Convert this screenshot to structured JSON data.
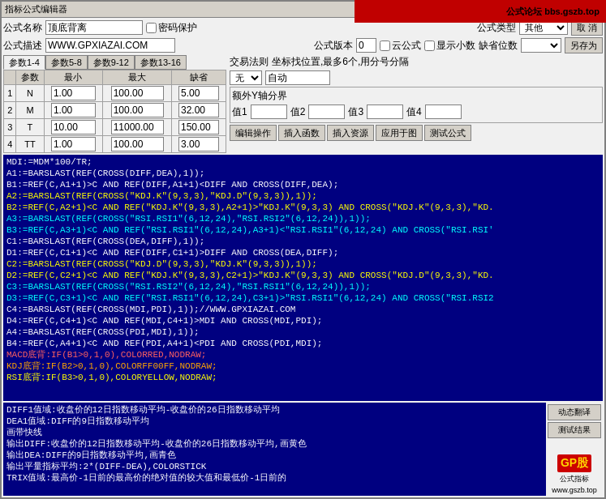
{
  "window": {
    "title": "指标公式编辑器"
  },
  "banner": {
    "text": "公式论坛 bbs.gszb.top"
  },
  "form": {
    "formula_name_label": "公式名称",
    "formula_name_value": "顶底背离",
    "password_label": "密码保护",
    "formula_type_label": "公式类型",
    "formula_type_value": "其他",
    "formula_desc_label": "公式描述",
    "formula_desc_value": "WWW.GPXIAZAI.COM",
    "formula_version_label": "公式版本",
    "formula_version_value": "0",
    "cloud_formula_label": "云公式",
    "show_small_label": "显示小数",
    "default_digits_label": "缺省位数",
    "cancel_btn": "取 消",
    "save_as_btn": "另存为"
  },
  "params": {
    "tabs": [
      "参数1-4",
      "参数5-8",
      "参数9-12",
      "参数13-16"
    ],
    "active_tab": 0,
    "headers": [
      "参数",
      "最小",
      "最大",
      "缺省"
    ],
    "rows": [
      {
        "num": "1",
        "name": "N",
        "min": "1.00",
        "max": "100.00",
        "default": "5.00"
      },
      {
        "num": "2",
        "name": "M",
        "min": "1.00",
        "max": "100.00",
        "default": "32.00"
      },
      {
        "num": "3",
        "name": "T",
        "min": "10.00",
        "max": "11000.00",
        "default": "150.00"
      },
      {
        "num": "4",
        "name": "TT",
        "min": "1.00",
        "max": "100.00",
        "default": "3.00"
      }
    ]
  },
  "exchange": {
    "label": "交易法则",
    "coord_label": "坐标找位置,最多6个,用分号分隔",
    "field1": "无",
    "field2": "自动"
  },
  "y_boundary": {
    "label": "额外Y轴分界",
    "val1_label": "值1",
    "val2_label": "值2",
    "val3_label": "值3",
    "val4_label": "值4"
  },
  "action_buttons": {
    "edit_ops": "编辑操作",
    "insert_fn": "插入函数",
    "insert_res": "插入资源",
    "apply_chart": "应用于图",
    "test_formula": "测试公式"
  },
  "code": [
    {
      "text": "MDI:=MDM*100/TR;",
      "color": "white"
    },
    {
      "text": "A1:=BARSLAST(REF(CROSS(DIFF,DEA),1));",
      "color": "white"
    },
    {
      "text": "B1:=REF(C,A1+1)>C AND REF(DIFF,A1+1)<DIFF AND CROSS(DIFF,DEA);",
      "color": "white"
    },
    {
      "text": "A2:=BARSLAST(REF(CROSS(\"KDJ.K\"(9,3,3),\"KDJ.D\"(9,3,3)),1));",
      "color": "yellow"
    },
    {
      "text": "B2:=REF(C,A2+1)<C AND REF(\"KDJ.K\"(9,3,3),A2+1)>\"KDJ.K\"(9,3,3) AND CROSS(\"KDJ.K\"(9,3,3),\"KD.",
      "color": "yellow"
    },
    {
      "text": "A3:=BARSLAST(REF(CROSS(\"RSI.RSI1\"(6,12,24),\"RSI.RSI2\"(6,12,24)),1));",
      "color": "cyan"
    },
    {
      "text": "B3:=REF(C,A3+1)<C AND REF(\"RSI.RSI1\"(6,12,24),A3+1)<\"RSI.RSI1\"(6,12,24) AND CROSS(\"RSI.RSI'",
      "color": "cyan"
    },
    {
      "text": "C1:=BARSLAST(REF(CROSS(DEA,DIFF),1));",
      "color": "white"
    },
    {
      "text": "D1:=REF(C,C1+1)<C AND REF(DIFF,C1+1)>DIFF AND CROSS(DEA,DIFF);",
      "color": "white"
    },
    {
      "text": "C2:=BARSLAST(REF(CROSS(\"KDJ.D\"(9,3,3),\"KDJ.K\"(9,3,3)),1));",
      "color": "yellow"
    },
    {
      "text": "D2:=REF(C,C2+1)<C AND REF(\"KDJ.K\"(9,3,3),C2+1)>\"KDJ.K\"(9,3,3) AND CROSS(\"KDJ.D\"(9,3,3),\"KD.",
      "color": "yellow"
    },
    {
      "text": "C3:=BARSLAST(REF(CROSS(\"RSI.RSI2\"(6,12,24),\"RSI.RSI1\"(6,12,24)),1));",
      "color": "cyan"
    },
    {
      "text": "D3:=REF(C,C3+1)<C AND REF(\"RSI.RSI1\"(6,12,24),C3+1)>\"RSI.RSI1\"(6,12,24) AND CROSS(\"RSI.RSI2",
      "color": "cyan"
    },
    {
      "text": "C4:=BARSLAST(REF(CROSS(MDI,PDI),1));//WWW.GPXIAZAI.COM",
      "color": "white"
    },
    {
      "text": "D4:=REF(C,C4+1)<C AND REF(MDI,C4+1)>MDI AND CROSS(MDI,PDI);",
      "color": "white"
    },
    {
      "text": "A4:=BARSLAST(REF(CROSS(PDI,MDI),1));",
      "color": "white"
    },
    {
      "text": "B4:=REF(C,A4+1)<C AND REF(PDI,A4+1)<PDI AND CROSS(PDI,MDI);",
      "color": "white"
    },
    {
      "text": "MACD底背:IF(B1>0,1,0),COLORRED,NODRAW;",
      "color": "red"
    },
    {
      "text": "KDJ底背:IF(B2>0,1,0),COLORFF00FF,NODRAW;",
      "color": "orange"
    },
    {
      "text": "RSI底背:IF(B3>0,1,0),COLORYELLOW,NODRAW;",
      "color": "yellow"
    }
  ],
  "desc_lines": [
    "DIFF1值域:收盘价的12日指数移动平均-收盘价的26日指数移动平均",
    "DEA1值域:DIFF的9日指数移动平均",
    "画带快线",
    "输出DIFF:收盘价的12日指数移动平均-收盘价的26日指数移动平均,画黄色",
    "输出DEA:DIFF的9日指数移动平均,画青色",
    "输出平量指标平均:2*(DIFF-DEA),COLORSTICK",
    "TRIX值域:最高价-1日前的最高价的绝对值的较大值和最低价-1日前的"
  ],
  "side_buttons": {
    "dynamic_translate": "动态翻译",
    "test_results": "测试结果"
  },
  "bottom_logos": {
    "gp_text": "GP股",
    "gp_subtext": "公式指标",
    "gp_url": "www.gszb.top"
  }
}
